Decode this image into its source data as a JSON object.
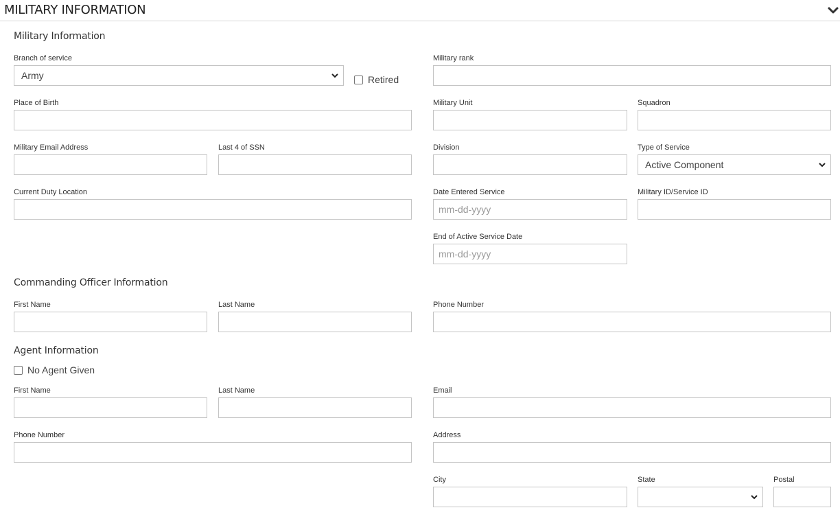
{
  "section": {
    "title": "MILITARY INFORMATION"
  },
  "military": {
    "heading": "Military Information",
    "branch": {
      "label": "Branch of service",
      "value": "Army"
    },
    "retired": {
      "label": "Retired"
    },
    "rank": {
      "label": "Military rank",
      "value": ""
    },
    "place_of_birth": {
      "label": "Place of Birth",
      "value": ""
    },
    "unit": {
      "label": "Military Unit",
      "value": ""
    },
    "squadron": {
      "label": "Squadron",
      "value": ""
    },
    "email": {
      "label": "Military Email Address",
      "value": ""
    },
    "ssn4": {
      "label": "Last 4 of SSN",
      "value": ""
    },
    "division": {
      "label": "Division",
      "value": ""
    },
    "service_type": {
      "label": "Type of Service",
      "value": "Active Component"
    },
    "duty_location": {
      "label": "Current Duty Location",
      "value": ""
    },
    "date_entered": {
      "label": "Date Entered Service",
      "placeholder": "mm-dd-yyyy"
    },
    "service_id": {
      "label": "Military ID/Service ID",
      "value": ""
    },
    "end_active": {
      "label": "End of Active Service Date",
      "placeholder": "mm-dd-yyyy"
    }
  },
  "commanding_officer": {
    "heading": "Commanding Officer Information",
    "first_name": {
      "label": "First Name"
    },
    "last_name": {
      "label": "Last Name"
    },
    "phone": {
      "label": "Phone Number"
    }
  },
  "agent": {
    "heading": "Agent Information",
    "no_agent": {
      "label": "No Agent Given"
    },
    "first_name": {
      "label": "First Name"
    },
    "last_name": {
      "label": "Last Name"
    },
    "email": {
      "label": "Email"
    },
    "phone": {
      "label": "Phone Number"
    },
    "address": {
      "label": "Address"
    },
    "city": {
      "label": "City"
    },
    "state": {
      "label": "State",
      "value": ""
    },
    "postal": {
      "label": "Postal"
    }
  },
  "icons": {
    "collapse": "chevron-down-icon",
    "select": "chevron-down-icon"
  }
}
